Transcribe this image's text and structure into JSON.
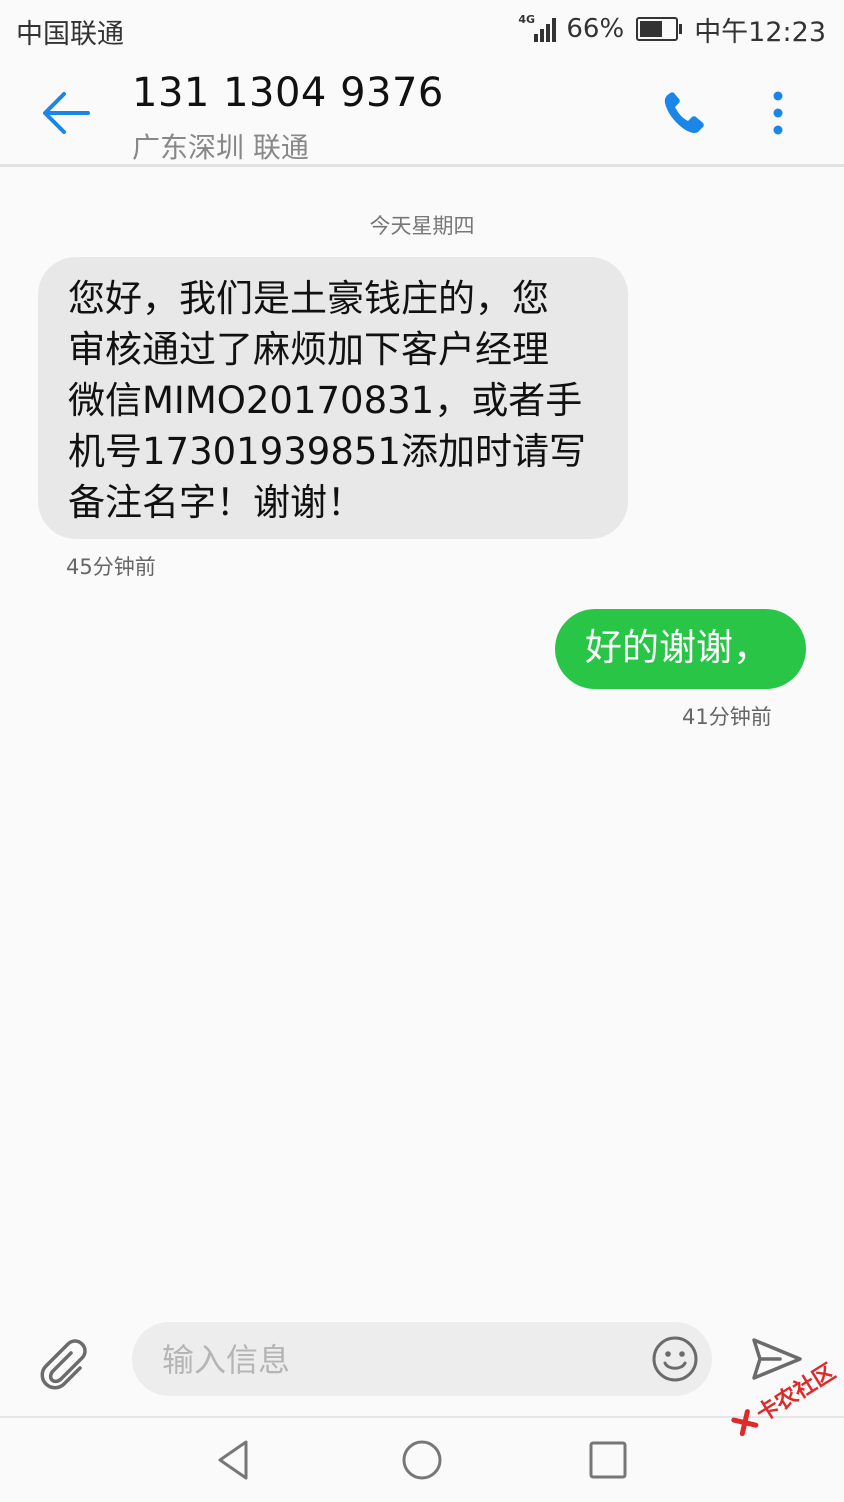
{
  "status_bar": {
    "carrier": "中国联通",
    "network_label": "4G",
    "battery_percent": "66%",
    "battery_level": 0.66,
    "time": "中午12:23"
  },
  "header": {
    "contact_number": "131 1304 9376",
    "contact_location": "广东深圳 联通",
    "icons": {
      "back": "back-arrow-icon",
      "call": "phone-icon",
      "more": "more-vertical-icon"
    },
    "accent_color": "#1a86e8"
  },
  "conversation": {
    "date_separator": "今天星期四",
    "messages": [
      {
        "direction": "incoming",
        "lines": [
          "您好，我们是土豪钱庄的，您",
          "审核通过了麻烦加下客户经理",
          "微信MIMO20170831，或者手",
          "机号17301939851添加时请写",
          "备注名字！谢谢！"
        ],
        "time": "45分钟前",
        "bubble_color": "#e8e8e8"
      },
      {
        "direction": "outgoing",
        "text": "好的谢谢，",
        "time": "41分钟前",
        "bubble_color": "#29c547"
      }
    ]
  },
  "composer": {
    "placeholder": "输入信息",
    "icons": {
      "attach": "paperclip-icon",
      "emoji": "emoji-icon",
      "send": "send-icon"
    }
  },
  "nav_bar": {
    "icons": {
      "back": "nav-back-icon",
      "home": "nav-home-icon",
      "recent": "nav-recent-icon"
    }
  },
  "watermark": {
    "text": "卡农社区",
    "color": "#e02a2a"
  }
}
